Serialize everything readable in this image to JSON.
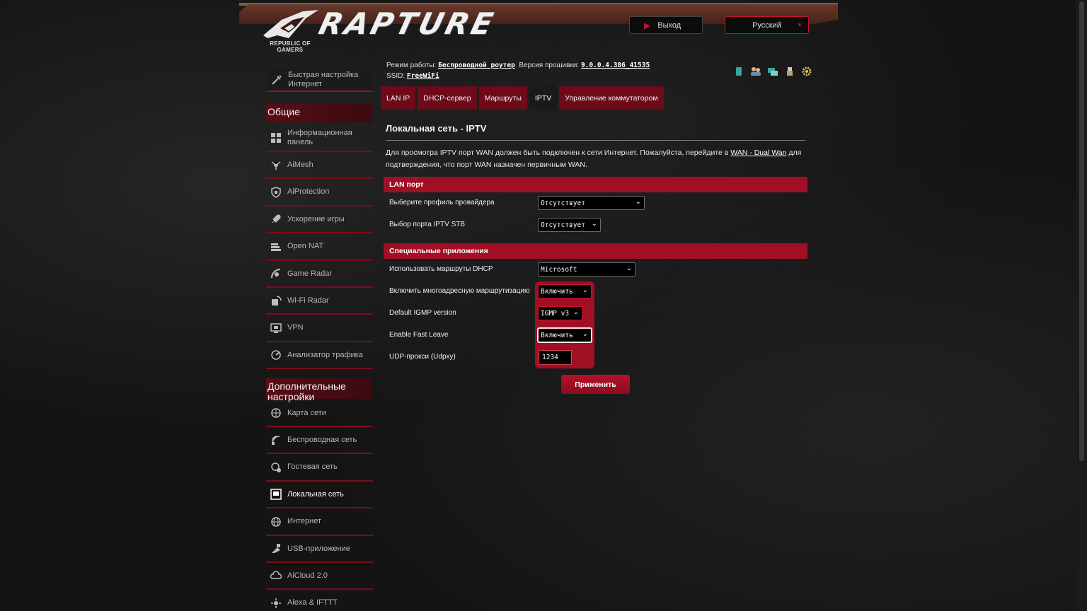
{
  "header": {
    "brand": "RAPTURE",
    "logo_text": "REPUBLIC OF GAMERS",
    "logout_label": "Выход",
    "language": "Русский"
  },
  "status": {
    "mode_label": "Режим работы:",
    "mode_value": "Беспроводной роутер",
    "firmware_label": "Версия прошивки:",
    "firmware_value": "9.0.0.4.386_41535",
    "ssid_label": "SSID:",
    "ssid_value": "FreeWiFi",
    "icons": [
      "sim-icon",
      "users-icon",
      "network-icon",
      "usb-icon",
      "settings-icon"
    ]
  },
  "sidebar": {
    "quick_setup": "Быстрая настройка Интернет",
    "general_title": "Общие",
    "general_items": [
      {
        "label": "Информационная панель",
        "icon": "dashboard-icon"
      },
      {
        "label": "AiMesh",
        "icon": "mesh-icon"
      },
      {
        "label": "AiProtection",
        "icon": "shield-icon"
      },
      {
        "label": "Ускорение игры",
        "icon": "rocket-icon"
      },
      {
        "label": "Open NAT",
        "icon": "nat-icon"
      },
      {
        "label": "Game Radar",
        "icon": "radar-icon"
      },
      {
        "label": "Wi-Fi Radar",
        "icon": "wifi-radar-icon"
      },
      {
        "label": "VPN",
        "icon": "vpn-icon"
      },
      {
        "label": "Анализатор трафика",
        "icon": "traffic-icon"
      }
    ],
    "advanced_title": "Дополнительные настройки",
    "advanced_items": [
      {
        "label": "Карта сети",
        "icon": "network-map-icon"
      },
      {
        "label": "Беспроводная сеть",
        "icon": "wireless-icon"
      },
      {
        "label": "Гостевая сеть",
        "icon": "guest-network-icon"
      },
      {
        "label": "Локальная сеть",
        "icon": "lan-icon"
      },
      {
        "label": "Интернет",
        "icon": "globe-icon"
      },
      {
        "label": "USB-приложение",
        "icon": "usb-app-icon"
      },
      {
        "label": "AiCloud 2.0",
        "icon": "cloud-icon"
      },
      {
        "label": "Alexa & IFTTT",
        "icon": "alexa-icon"
      }
    ],
    "active_item": "Локальная сеть"
  },
  "tabs": [
    {
      "label": "LAN IP"
    },
    {
      "label": "DHCP-сервер"
    },
    {
      "label": "Маршруты"
    },
    {
      "label": "IPTV"
    },
    {
      "label": "Управление коммутатором"
    }
  ],
  "active_tab": "IPTV",
  "page": {
    "title": "Локальная сеть - IPTV",
    "desc_part1": "Для просмотра IPTV порт WAN должен быть подключен к сети Интернет. Пожалуйста, перейдите в ",
    "desc_link": "WAN - Dual Wan",
    "desc_part2": " для подтверждения, что порт WAN назначен первичным WAN."
  },
  "lan_port": {
    "heading": "LAN порт",
    "isp_profile_label": "Выберите профиль провайдера",
    "isp_profile_value": "Отсутствует",
    "stb_port_label": "Выбор порта IPTV STB",
    "stb_port_value": "Отсутствует"
  },
  "special_apps": {
    "heading": "Специальные приложения",
    "dhcp_routes_label": "Использовать маршруты DHCP",
    "dhcp_routes_value": "Microsoft",
    "multicast_label": "Включить многоадресную маршрутизацию",
    "multicast_value": "Включить",
    "igmp_label": "Default IGMP version",
    "igmp_value": "IGMP v3",
    "fast_leave_label": "Enable Fast Leave",
    "fast_leave_value": "Включить",
    "udpxy_label": "UDP-прокси (Udpxy)",
    "udpxy_value": "1234"
  },
  "apply_label": "Применить",
  "colors": {
    "accent": "#a00f24",
    "tab": "#6d0c18",
    "background": "#141414"
  }
}
